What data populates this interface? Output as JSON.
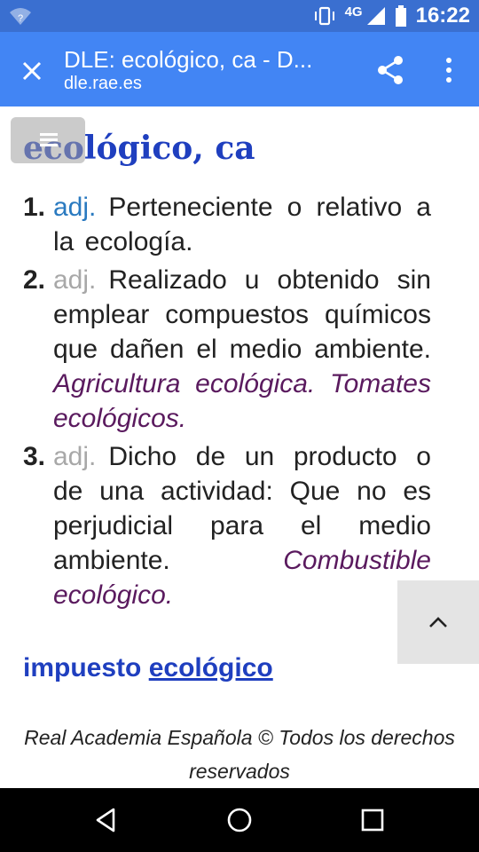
{
  "status_bar": {
    "time": "16:22",
    "network": "4G",
    "wifi_badge": "?",
    "icons": [
      "wifi-icon",
      "vibrate-icon",
      "signal-icon",
      "battery-icon"
    ]
  },
  "app_bar": {
    "title": "DLE: ecológico, ca - D...",
    "url": "dle.rae.es",
    "icons": [
      "close-icon",
      "share-icon",
      "more-vert-icon"
    ]
  },
  "content": {
    "headword": "ecológico, ca",
    "entries": [
      {
        "number": "1.",
        "abbr": "adj.",
        "abbr_muted": false,
        "definition": "Perteneciente o relativo a la ecología.",
        "examples": ""
      },
      {
        "number": "2.",
        "abbr": "adj.",
        "abbr_muted": true,
        "definition": "Realizado u obtenido sin emplear compuestos químicos que dañen el medio ambiente.",
        "examples": "Agricultura ecológica. Tomates ecológicos."
      },
      {
        "number": "3.",
        "abbr": "adj.",
        "abbr_muted": true,
        "definition": "Dicho de un producto o de una actividad: Que no es perjudicial para el medio ambiente.",
        "examples": "Combustible ecológico."
      }
    ],
    "locution": {
      "text": "impuesto",
      "link": "ecológico"
    },
    "footer": "Real Academia Española © Todos los derechos reservados"
  },
  "colors": {
    "status_bar": "#3a6fd0",
    "app_bar": "#4285f4",
    "headword": "#1f3fbf",
    "abbr_active": "#2a7ac0",
    "abbr_muted": "#a8a8a8",
    "example": "#5a1a5e"
  },
  "nav_bar": {
    "icons": [
      "back-icon",
      "home-icon",
      "recents-icon"
    ]
  }
}
